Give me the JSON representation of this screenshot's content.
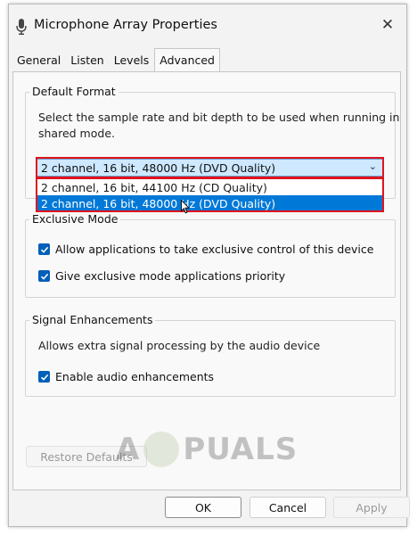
{
  "window": {
    "title": "Microphone Array Properties",
    "close_glyph": "✕"
  },
  "tabs": [
    {
      "label": "General"
    },
    {
      "label": "Listen"
    },
    {
      "label": "Levels"
    },
    {
      "label": "Advanced",
      "active": true
    }
  ],
  "default_format": {
    "group_title": "Default Format",
    "description_line1": "Select the sample rate and bit depth to be used when running in",
    "description_line2": "shared mode.",
    "selected_value": "2 channel, 16 bit, 48000 Hz (DVD Quality)",
    "options": [
      "2 channel, 16 bit, 44100 Hz (CD Quality)",
      "2 channel, 16 bit, 48000 Hz (DVD Quality)"
    ],
    "hovered_option_index": 1
  },
  "exclusive_mode": {
    "group_title": "Exclusive Mode",
    "checkboxes": [
      {
        "label": "Allow applications to take exclusive control of this device",
        "checked": true
      },
      {
        "label": "Give exclusive mode applications priority",
        "checked": true
      }
    ]
  },
  "signal_enhancements": {
    "group_title": "Signal Enhancements",
    "description": "Allows extra signal processing by the audio device",
    "checkbox": {
      "label": "Enable audio enhancements",
      "checked": true
    }
  },
  "buttons": {
    "restore_defaults": "Restore Defaults",
    "ok": "OK",
    "cancel": "Cancel",
    "apply": "Apply"
  },
  "watermark": {
    "left": "A",
    "right": "PUALS"
  },
  "colors": {
    "accent": "#005fb8",
    "selection": "#0078d7",
    "combo_bg": "#cde8ff",
    "annotation_red": "#e0141d"
  },
  "icons": {
    "title": "microphone-icon",
    "close": "close-icon",
    "combo_arrow": "chevron-down-icon",
    "check": "checkmark-icon",
    "cursor": "mouse-pointer-icon"
  }
}
